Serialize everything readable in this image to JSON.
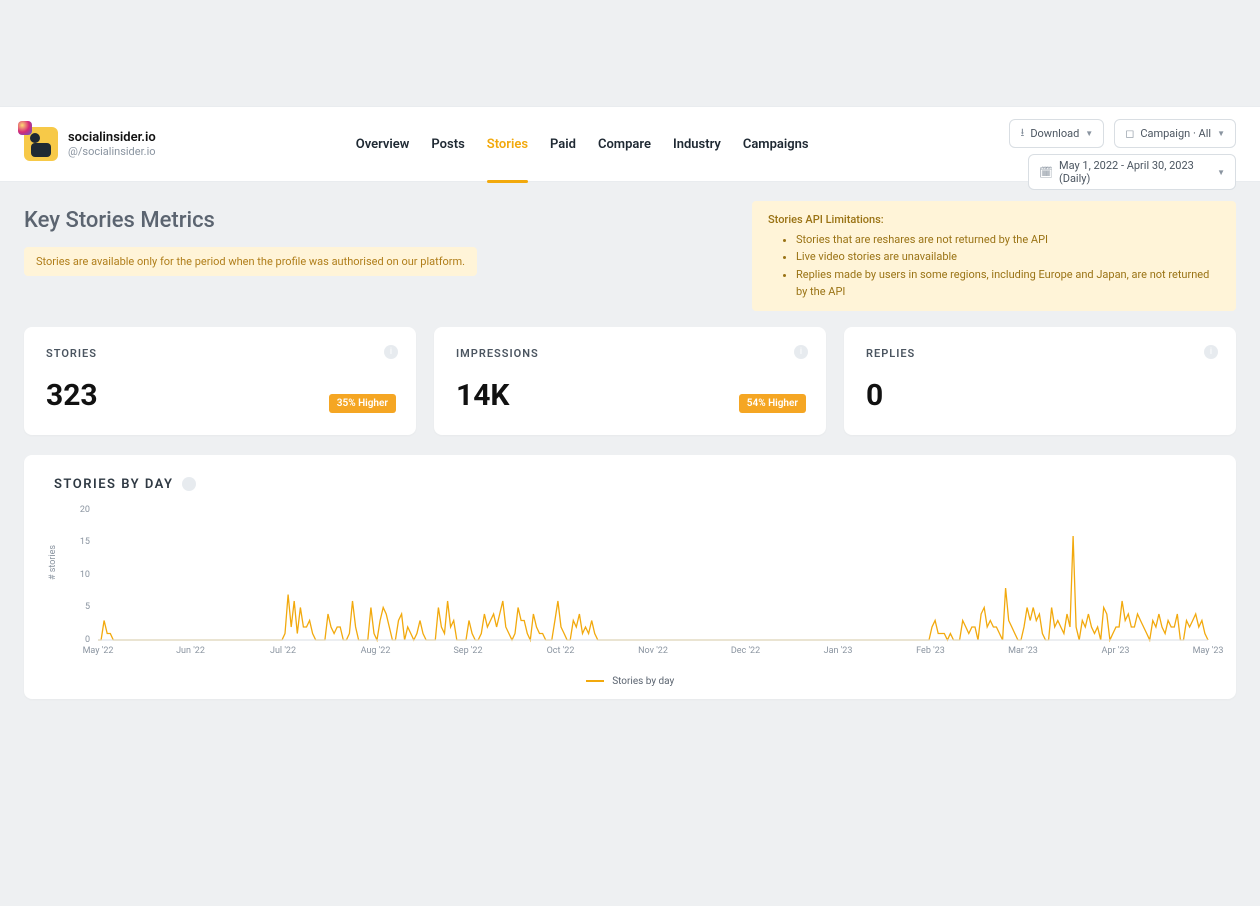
{
  "header": {
    "brand_title": "socialinsider.io",
    "brand_handle": "@/socialinsider.io",
    "tabs": [
      {
        "label": "Overview"
      },
      {
        "label": "Posts"
      },
      {
        "label": "Stories",
        "active": true
      },
      {
        "label": "Paid"
      },
      {
        "label": "Compare"
      },
      {
        "label": "Industry"
      },
      {
        "label": "Campaigns"
      }
    ],
    "download_label": "Download",
    "campaign_filter": "Campaign · All",
    "date_range": "May 1, 2022 - April 30, 2023 (Daily)"
  },
  "page": {
    "title": "Key Stories Metrics",
    "availability_note": "Stories are available only for the period when the profile was authorised on our platform.",
    "limitations_title": "Stories API Limitations:",
    "limitations": [
      "Stories that are reshares are not returned by the API",
      "Live video stories are unavailable",
      "Replies made by users in some regions, including Europe and Japan, are not returned by the API"
    ]
  },
  "metrics": {
    "stories": {
      "label": "STORIES",
      "value": "323",
      "badge": "35% Higher"
    },
    "impressions": {
      "label": "IMPRESSIONS",
      "value": "14K",
      "badge": "54% Higher"
    },
    "replies": {
      "label": "REPLIES",
      "value": "0"
    }
  },
  "chart": {
    "title": "STORIES BY DAY",
    "ylabel": "# stories",
    "legend_label": "Stories by day"
  },
  "chart_data": {
    "type": "line",
    "title": "STORIES BY DAY",
    "xlabel": "",
    "ylabel": "# stories",
    "ylim": [
      0,
      20
    ],
    "y_ticks": [
      0,
      5,
      10,
      15,
      20
    ],
    "x_tick_labels": [
      "May '22",
      "Jun '22",
      "Jul '22",
      "Aug '22",
      "Sep '22",
      "Oct '22",
      "Nov '22",
      "Dec '22",
      "Jan '23",
      "Feb '23",
      "Mar '23",
      "Apr '23",
      "May '23"
    ],
    "series": [
      {
        "name": "Stories by day",
        "color": "#f2a90d",
        "values": [
          0,
          0,
          3,
          1,
          1,
          0,
          0,
          0,
          0,
          0,
          0,
          0,
          0,
          0,
          0,
          0,
          0,
          0,
          0,
          0,
          0,
          0,
          0,
          0,
          0,
          0,
          0,
          0,
          0,
          0,
          0,
          0,
          0,
          0,
          0,
          0,
          0,
          0,
          0,
          0,
          0,
          0,
          0,
          0,
          0,
          0,
          0,
          0,
          0,
          0,
          0,
          0,
          0,
          0,
          0,
          0,
          0,
          0,
          0,
          0,
          0,
          1,
          7,
          2,
          6,
          1,
          5,
          2,
          2,
          3,
          1,
          0,
          0,
          0,
          0,
          4,
          2,
          1,
          2,
          2,
          0,
          0,
          1,
          6,
          2,
          0,
          0,
          0,
          0,
          5,
          1,
          0,
          3,
          5,
          4,
          2,
          0,
          0,
          3,
          4,
          0,
          2,
          1,
          0,
          1,
          3,
          1,
          0,
          0,
          0,
          0,
          5,
          2,
          1,
          6,
          2,
          3,
          0,
          0,
          0,
          0,
          3,
          1,
          0,
          0,
          1,
          4,
          2,
          3,
          4,
          2,
          4,
          6,
          2,
          1,
          0,
          1,
          5,
          3,
          3,
          1,
          0,
          4,
          2,
          1,
          1,
          0,
          0,
          0,
          3,
          6,
          2,
          1,
          0,
          0,
          3,
          2,
          4,
          1,
          2,
          1,
          3,
          1,
          0,
          0,
          0,
          0,
          0,
          0,
          0,
          0,
          0,
          0,
          0,
          0,
          0,
          0,
          0,
          0,
          0,
          0,
          0,
          0,
          0,
          0,
          0,
          0,
          0,
          0,
          0,
          0,
          0,
          0,
          0,
          0,
          0,
          0,
          0,
          0,
          0,
          0,
          0,
          0,
          0,
          0,
          0,
          0,
          0,
          0,
          0,
          0,
          0,
          0,
          0,
          0,
          0,
          0,
          0,
          0,
          0,
          0,
          0,
          0,
          0,
          0,
          0,
          0,
          0,
          0,
          0,
          0,
          0,
          0,
          0,
          0,
          0,
          0,
          0,
          0,
          0,
          0,
          0,
          0,
          0,
          0,
          0,
          0,
          0,
          0,
          0,
          0,
          0,
          0,
          0,
          0,
          0,
          0,
          0,
          0,
          0,
          0,
          0,
          0,
          0,
          0,
          0,
          0,
          0,
          0,
          0,
          0,
          0,
          2,
          3,
          1,
          1,
          1,
          0,
          1,
          0,
          0,
          0,
          3,
          2,
          1,
          2,
          2,
          0,
          4,
          5,
          2,
          3,
          2,
          2,
          1,
          0,
          8,
          3,
          2,
          1,
          0,
          0,
          2,
          5,
          3,
          5,
          3,
          4,
          1,
          0,
          0,
          5,
          2,
          3,
          2,
          1,
          4,
          2,
          16,
          2,
          0,
          3,
          2,
          4,
          2,
          1,
          2,
          0,
          5,
          4,
          0,
          1,
          2,
          2,
          6,
          3,
          4,
          2,
          2,
          4,
          3,
          2,
          1,
          0,
          3,
          2,
          4,
          2,
          1,
          3,
          2,
          2,
          4,
          0,
          0,
          3,
          2,
          3,
          4,
          2,
          3,
          1,
          0
        ]
      }
    ]
  }
}
